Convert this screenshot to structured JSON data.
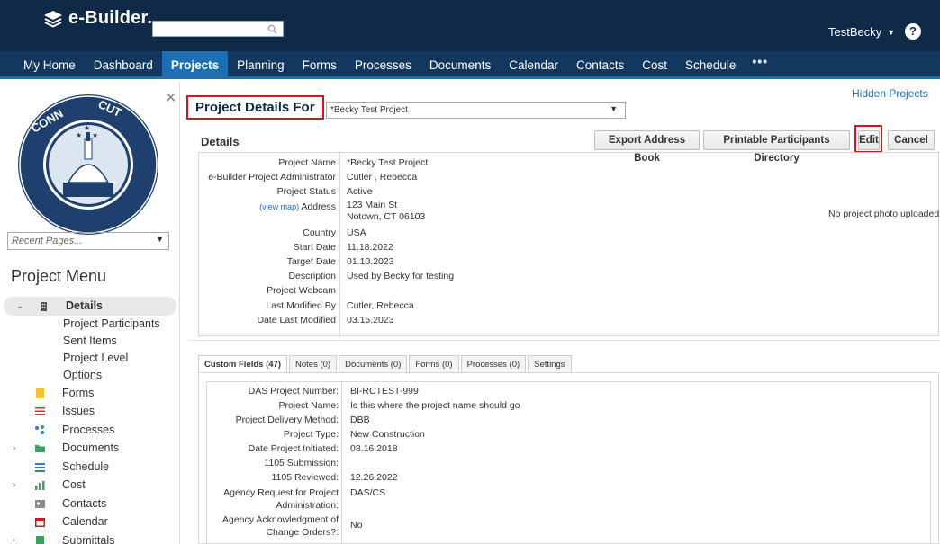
{
  "app": {
    "logo": "e-Builder."
  },
  "header": {
    "user": "TestBecky",
    "help": "?"
  },
  "nav": [
    "My Home",
    "Dashboard",
    "Projects",
    "Planning",
    "Forms",
    "Processes",
    "Documents",
    "Calendar",
    "Contacts",
    "Cost",
    "Schedule"
  ],
  "nav_active": "Projects",
  "nav_more": "•••",
  "sidebar": {
    "recent_placeholder": "Recent Pages...",
    "menu_title": "Project Menu",
    "selected": "Details",
    "details_children": [
      "Project Participants",
      "Sent Items",
      "Project Level",
      "Options"
    ],
    "items": [
      "Forms",
      "Issues",
      "Processes",
      "Documents",
      "Schedule",
      "Cost",
      "Contacts",
      "Calendar",
      "Submittals"
    ]
  },
  "page": {
    "hidden_projects": "Hidden Projects",
    "title": "Project Details For",
    "project_selected": "*Becky Test Project",
    "section": "Details",
    "buttons": {
      "export": "Export Address Book",
      "printable": "Printable Participants Directory",
      "edit": "Edit",
      "cancel": "Cancel"
    },
    "no_photo": "No project photo uploaded."
  },
  "details": {
    "view_map": "(view map)",
    "labels": [
      "Project Name",
      "e-Builder Project Administrator",
      "Project Status",
      "Address",
      "Country",
      "Start Date",
      "Target Date",
      "Description",
      "Project Webcam",
      "Last Modified By",
      "Date Last Modified"
    ],
    "values": [
      "*Becky Test Project",
      "Cutler , Rebecca",
      "Active",
      "123 Main St",
      "Notown, CT 06103",
      "USA",
      "11.18.2022",
      "01.10.2023",
      "Used by Becky for testing",
      "",
      "Cutler, Rebecca",
      "03.15.2023"
    ]
  },
  "tabs": [
    "Custom Fields (47)",
    "Notes (0)",
    "Documents (0)",
    "Forms (0)",
    "Processes (0)",
    "Settings"
  ],
  "custom_fields": {
    "labels": [
      "DAS Project Number:",
      "Project Name:",
      "Project Delivery Method:",
      "Project Type:",
      "Date Project Initiated:",
      "1105 Submission:",
      "1105 Reviewed:",
      "Agency Request for Project Administration:",
      "Agency Acknowledgment of Change Orders?:"
    ],
    "values": [
      "BI-RCTEST-999",
      "Is this where the project name should go",
      "DBB",
      "New Construction",
      "08.16.2018",
      "",
      "12.26.2022",
      "DAS/CS",
      "No"
    ]
  }
}
